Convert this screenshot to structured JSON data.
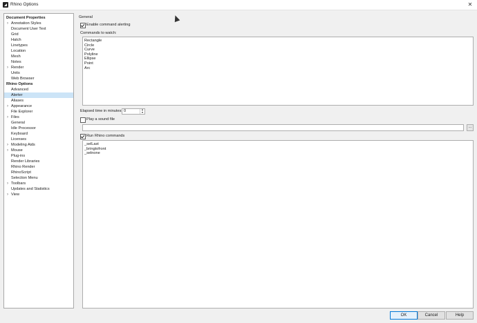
{
  "window": {
    "title": "Rhino Options",
    "close_glyph": "✕"
  },
  "tree": {
    "rows": [
      {
        "label": "Document Properties",
        "header": true
      },
      {
        "label": "Annotation Styles",
        "chevron": true
      },
      {
        "label": "Document User Text"
      },
      {
        "label": "Grid"
      },
      {
        "label": "Hatch"
      },
      {
        "label": "Linetypes"
      },
      {
        "label": "Location"
      },
      {
        "label": "Mesh"
      },
      {
        "label": "Notes"
      },
      {
        "label": "Render",
        "chevron": true
      },
      {
        "label": "Units"
      },
      {
        "label": "Web Browser"
      },
      {
        "label": "Rhino Options",
        "header": true
      },
      {
        "label": "Advanced"
      },
      {
        "label": "Alerter",
        "selected": true
      },
      {
        "label": "Aliases"
      },
      {
        "label": "Appearance",
        "chevron": true
      },
      {
        "label": "File Explorer"
      },
      {
        "label": "Files",
        "chevron": true
      },
      {
        "label": "General"
      },
      {
        "label": "Idle Processor"
      },
      {
        "label": "Keyboard"
      },
      {
        "label": "Licenses"
      },
      {
        "label": "Modeling Aids",
        "chevron": true
      },
      {
        "label": "Mouse",
        "chevron": true
      },
      {
        "label": "Plug-ins"
      },
      {
        "label": "Render Libraries"
      },
      {
        "label": "Rhino Render"
      },
      {
        "label": "RhinoScript"
      },
      {
        "label": "Selection Menu"
      },
      {
        "label": "Toolbars",
        "chevron": true
      },
      {
        "label": "Updates and Statistics"
      },
      {
        "label": "View",
        "chevron": true
      }
    ],
    "chevron_glyph": "›"
  },
  "panel": {
    "section": "General",
    "enable_alerting": "Enable command alerting",
    "commands_label": "Commands to watch:",
    "commands": [
      "Rectangle",
      "Circle",
      "Curve",
      "Polyline",
      "Ellipse",
      "Point",
      "Arc"
    ],
    "elapsed_label": "Elapsed time in minutes:",
    "elapsed_value": "0",
    "play_sound": "Play a sound file",
    "browse_label": "...",
    "run_commands": "Run Rhino commands",
    "run_list": [
      "_selLast",
      "_bringtofront",
      "_selnone"
    ]
  },
  "buttons": {
    "ok": "OK",
    "cancel": "Cancel",
    "help": "Help"
  }
}
